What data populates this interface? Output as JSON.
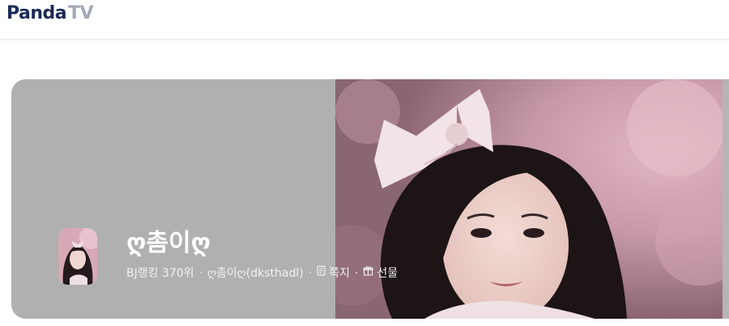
{
  "header": {
    "logo_main": "Panda",
    "logo_accent": "TV"
  },
  "profile": {
    "name": "ღ촘이ღ",
    "ranking": "BJ랭킹 370위",
    "user_id": "ღ촘이ღ(dksthadl)",
    "message_label": "쪽지",
    "gift_label": "선물",
    "message_icon": "message-icon",
    "gift_icon": "gift-icon"
  },
  "colors": {
    "panel_gray": "#b0b0b0",
    "logo_main": "#1c2a55",
    "logo_accent": "#a3a8b8"
  }
}
